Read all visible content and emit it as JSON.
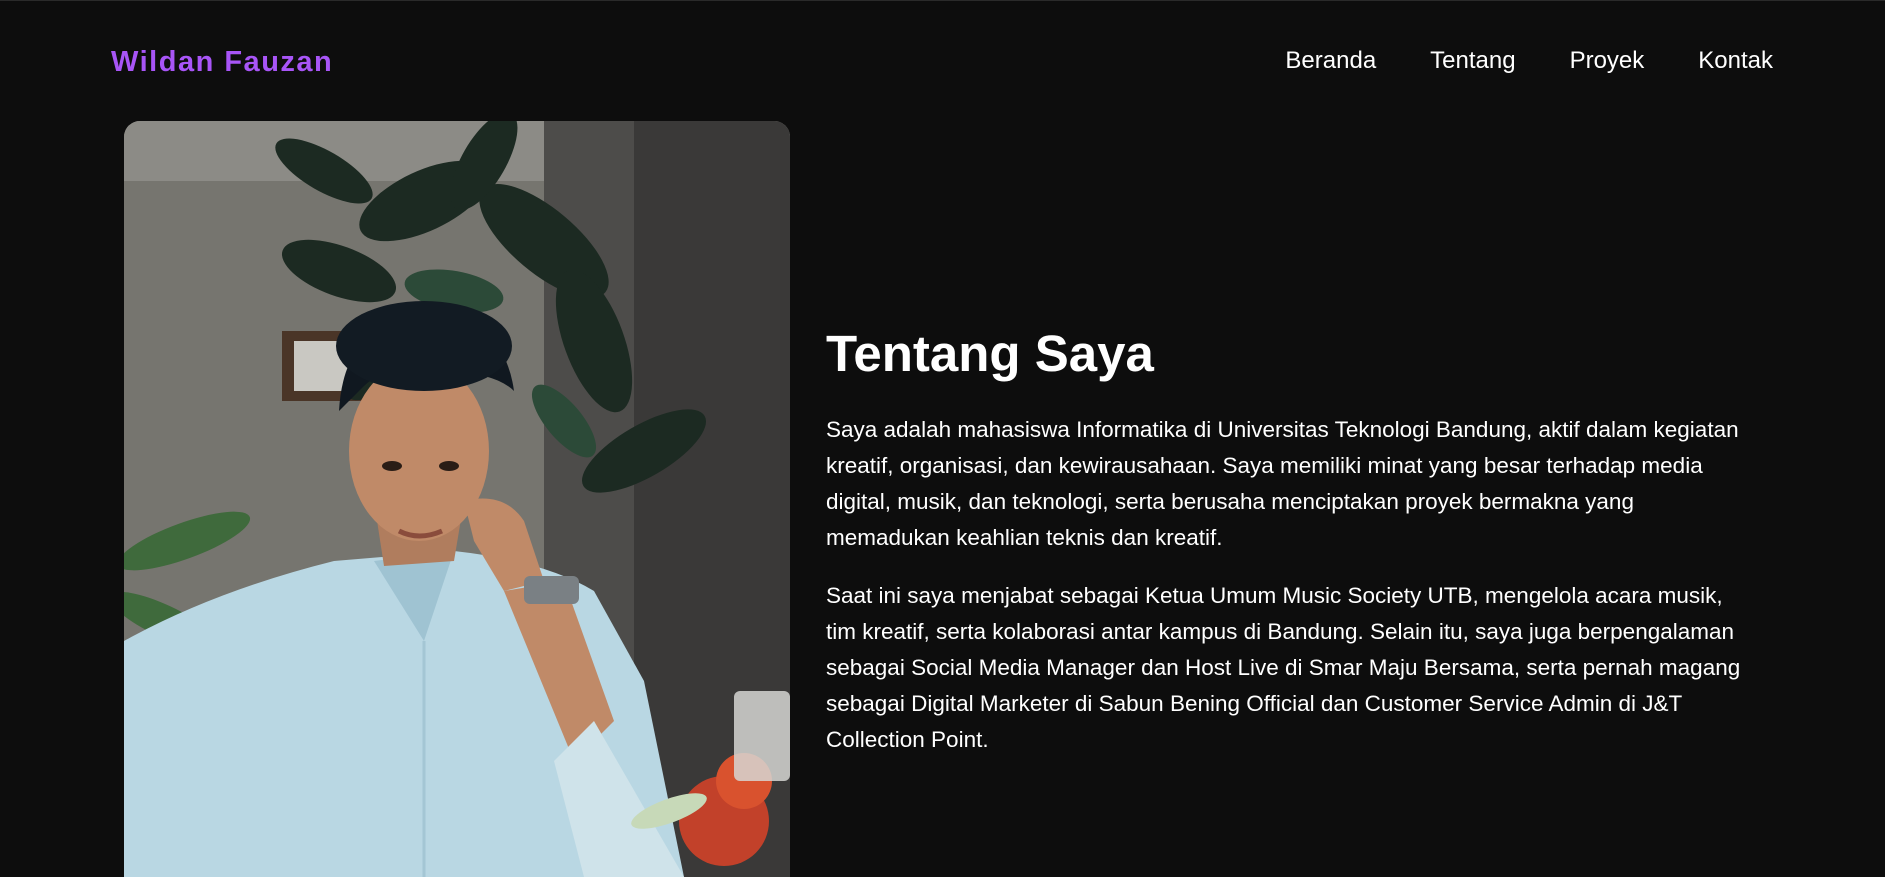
{
  "header": {
    "brand": "Wildan Fauzan",
    "nav": [
      {
        "label": "Beranda"
      },
      {
        "label": "Tentang"
      },
      {
        "label": "Proyek"
      },
      {
        "label": "Kontak"
      }
    ]
  },
  "colors": {
    "background": "#0d0d0d",
    "brand_accent": "#a855f7",
    "text": "#ffffff"
  },
  "about": {
    "title": "Tentang Saya",
    "paragraphs": [
      "Saya adalah mahasiswa Informatika di Universitas Teknologi Bandung, aktif dalam kegiatan kreatif, organisasi, dan kewirausahaan. Saya memiliki minat yang besar terhadap media digital, musik, dan teknologi, serta berusaha menciptakan proyek bermakna yang memadukan keahlian teknis dan kreatif.",
      "Saat ini saya menjabat sebagai Ketua Umum Music Society UTB, mengelola acara musik, tim kreatif, serta kolaborasi antar kampus di Bandung. Selain itu, saya juga berpengalaman sebagai Social Media Manager dan Host Live di Smar Maju Bersama, serta pernah magang sebagai Digital Marketer di Sabun Bening Official dan Customer Service Admin di J&T Collection Point."
    ]
  }
}
